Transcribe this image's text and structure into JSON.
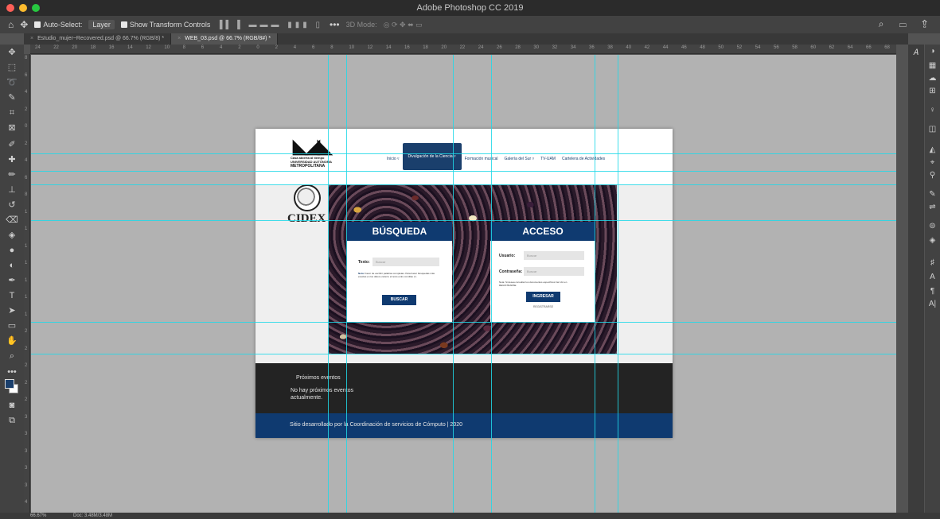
{
  "window": {
    "title": "Adobe Photoshop CC 2019"
  },
  "options_bar": {
    "auto_select_label": "Auto-Select:",
    "auto_select_value": "Layer",
    "show_transform_label": "Show Transform Controls",
    "mode_3d_label": "3D Mode:"
  },
  "tabs": [
    {
      "label": "Estudio_mujer~Recovered.psd @ 66.7% (RGB/8) *",
      "active": false
    },
    {
      "label": "WEB_03.psd @ 66.7% (RGB/8#) *",
      "active": true
    }
  ],
  "ruler": {
    "h_ticks": [
      "24",
      "22",
      "20",
      "18",
      "16",
      "14",
      "12",
      "10",
      "8",
      "6",
      "4",
      "2",
      "0",
      "2",
      "4",
      "6",
      "8",
      "10",
      "12",
      "14",
      "16",
      "18",
      "20",
      "22",
      "24",
      "26",
      "28",
      "30",
      "32",
      "34",
      "36",
      "38",
      "40",
      "42",
      "44",
      "46",
      "48",
      "50",
      "52",
      "54",
      "56",
      "58",
      "60",
      "62",
      "64",
      "66",
      "68"
    ],
    "v_ticks": [
      "8",
      "6",
      "4",
      "2",
      "0",
      "2",
      "4",
      "6",
      "8",
      "1",
      "1",
      "1",
      "1",
      "1",
      "1",
      "1",
      "2",
      "2",
      "2",
      "2",
      "2",
      "3",
      "3",
      "3",
      "3",
      "3",
      "4"
    ]
  },
  "document": {
    "logo": {
      "tagline": "Casa abierta al tiempo",
      "line2": "UNIVERSIDAD AUTÓNOMA",
      "line3": "METROPOLITANA"
    },
    "nav": [
      {
        "label": "Inicio ▿",
        "selected": false
      },
      {
        "label": "Divulgación de la Ciencia ▿",
        "selected": true
      },
      {
        "label": "Formación musical",
        "selected": false
      },
      {
        "label": "Galería del Sur ▿",
        "selected": false
      },
      {
        "label": "TV-UAM",
        "selected": false
      },
      {
        "label": "Cartelera de Actividades",
        "selected": false
      }
    ],
    "cidex_label": "CIDEX",
    "busqueda": {
      "title": "BÚSQUEDA",
      "field_label": "Texto:",
      "field_placeholder": "Buscar",
      "note_prefix": "Nota:",
      "note_text": "Favor de escribir palabras completas. Para hacer búsquedas más exactas en los datos encierre el texto entre comillas (\").",
      "button": "BUSCAR"
    },
    "acceso": {
      "title": "ACCESO",
      "user_label": "Usuario:",
      "user_placeholder": "Buscar",
      "pass_label": "Contraseña:",
      "pass_placeholder": "Buscar",
      "note_text": "Nota: Si desea consultar los documentos específicos haz clic en REGISTRARSE",
      "button": "INGRESAR",
      "register": "REGISTRARSE"
    },
    "events_title": "Próximos eventos",
    "events_text": "No hay próximos eventos actualmente.",
    "footer_text": "Sitio desarrollado por la Coordinación de servicios de Cómputo | 2020"
  },
  "status": {
    "zoom": "66.67%",
    "doc": "Doc: 3.48M/3.48M"
  },
  "colors": {
    "accent": "#0f3a70",
    "guide": "#20d8e8"
  }
}
